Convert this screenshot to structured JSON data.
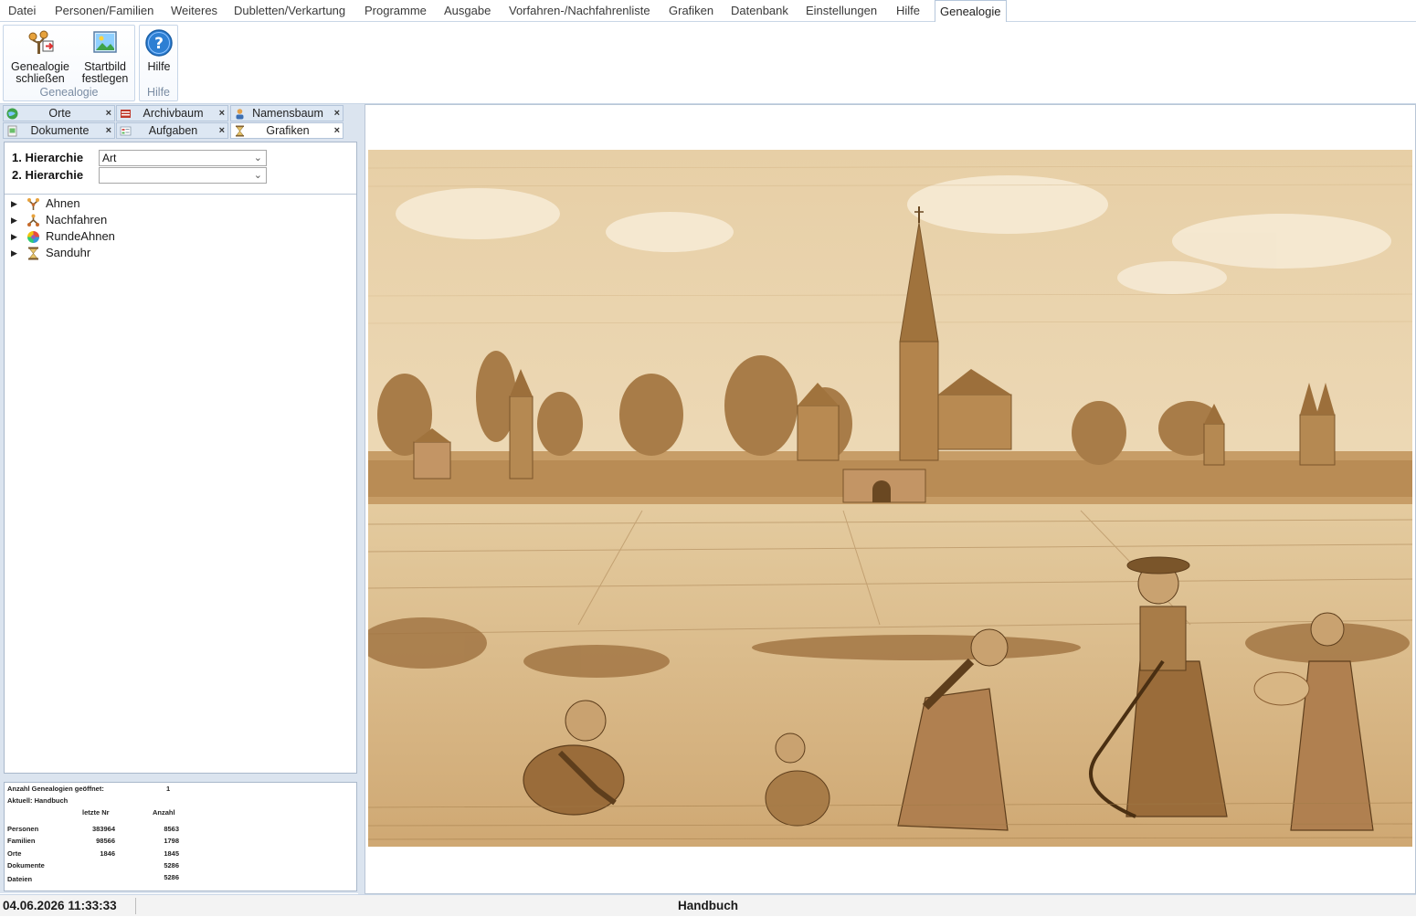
{
  "menu": {
    "items": [
      "Datei",
      "Personen/Familien",
      "Weiteres",
      "Dubletten/Verkartung",
      "Programme",
      "Ausgabe",
      "Vorfahren-/Nachfahrenliste",
      "Grafiken",
      "Datenbank",
      "Einstellungen",
      "Hilfe"
    ],
    "active": "Genealogie"
  },
  "ribbon": {
    "genealogie_group": {
      "label": "Genealogie",
      "close_line1": "Genealogie",
      "close_line2": "schließen",
      "startbild_line1": "Startbild",
      "startbild_line2": "festlegen"
    },
    "hilfe_group": {
      "label": "Hilfe",
      "hilfe_button": "Hilfe"
    }
  },
  "tabs": {
    "row1": [
      "Orte",
      "Archivbaum",
      "Namensbaum"
    ],
    "row2": [
      "Dokumente",
      "Aufgaben",
      "Grafiken"
    ],
    "close_glyph": "×"
  },
  "hierarchy": {
    "label1": "1. Hierarchie",
    "value1": "Art",
    "label2": "2. Hierarchie",
    "value2": ""
  },
  "tree": [
    "Ahnen",
    "Nachfahren",
    "RundeAhnen",
    "Sanduhr"
  ],
  "stats": {
    "opened_label": "Anzahl Genealogien geöffnet:",
    "opened_value": "1",
    "current": "Aktuell: Handbuch",
    "col_last": "letzte Nr",
    "col_count": "Anzahl",
    "rows": [
      {
        "name": "Personen",
        "last": "383964",
        "count": "8563"
      },
      {
        "name": "Familien",
        "last": "98566",
        "count": "1798"
      },
      {
        "name": "Orte",
        "last": "1846",
        "count": "1845"
      },
      {
        "name": "Dokumente",
        "last": "",
        "count": "5286"
      },
      {
        "name": "Dateien",
        "last": "",
        "count": "5286"
      }
    ]
  },
  "status": {
    "datetime": "04.06.2026  11:33:33",
    "database": "Handbuch"
  },
  "colors": {
    "accent": "#dbe4ef",
    "border": "#b4c5da",
    "sepia_light": "#efdcbc",
    "sepia_dark": "#8a5e32"
  }
}
